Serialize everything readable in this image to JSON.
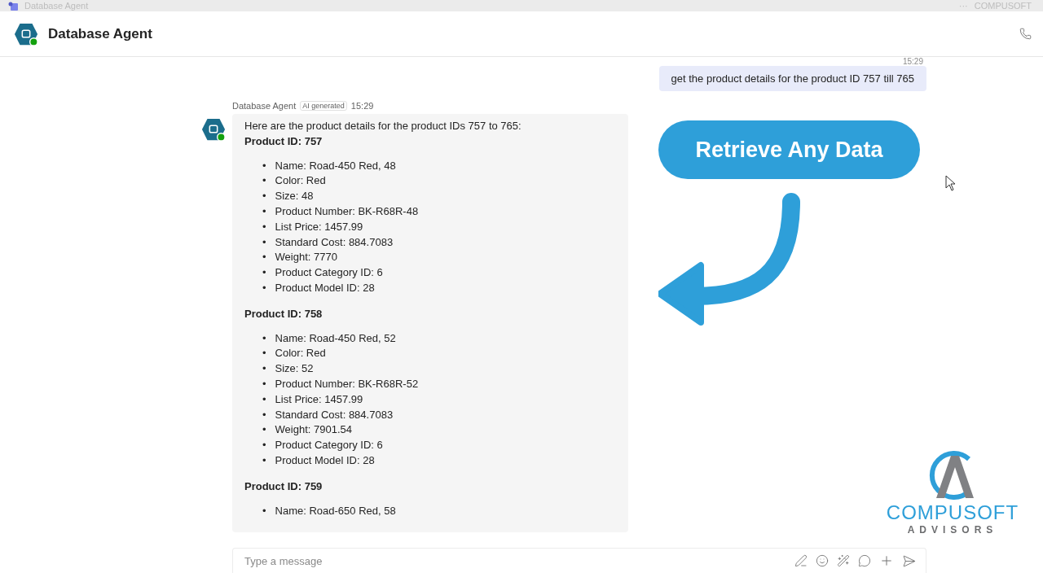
{
  "title_bar": {
    "title": "Database Agent",
    "more": "···",
    "org": "COMPUSOFT"
  },
  "header": {
    "title": "Database Agent"
  },
  "user_message": {
    "time": "15:29",
    "text": "get the product details for the product ID 757 till 765"
  },
  "bot_message": {
    "bullet": "•",
    "sender": "Database Agent",
    "badge": "AI generated",
    "time": "15:29",
    "intro": "Here are the product details for the product IDs 757 to 765:",
    "products": [
      {
        "heading": "Product ID: 757",
        "items": [
          "Name: Road-450 Red, 48",
          "Color: Red",
          "Size: 48",
          "Product Number: BK-R68R-48",
          "List Price: 1457.99",
          "Standard Cost: 884.7083",
          "Weight: 7770",
          "Product Category ID: 6",
          "Product Model ID: 28"
        ]
      },
      {
        "heading": "Product ID: 758",
        "items": [
          "Name: Road-450 Red, 52",
          "Color: Red",
          "Size: 52",
          "Product Number: BK-R68R-52",
          "List Price: 1457.99",
          "Standard Cost: 884.7083",
          "Weight: 7901.54",
          "Product Category ID: 6",
          "Product Model ID: 28"
        ]
      },
      {
        "heading": "Product ID: 759",
        "items": [
          "Name: Road-650 Red, 58"
        ]
      }
    ]
  },
  "composer": {
    "placeholder": "Type a message"
  },
  "overlay": {
    "callout": "Retrieve Any Data",
    "logo_top": "COMPUSOFT",
    "logo_bottom": "ADVISORS"
  }
}
